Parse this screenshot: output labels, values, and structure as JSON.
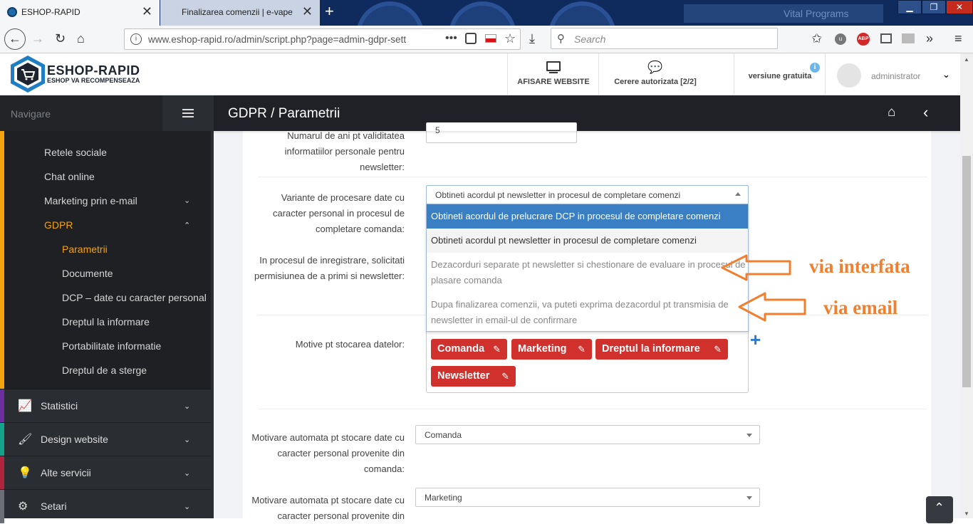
{
  "browser": {
    "tabs": [
      {
        "label": "ESHOP-RAPID",
        "active": true
      },
      {
        "label": "Finalizarea comenzii | e-vape",
        "active": false
      }
    ],
    "background_text": "Vital Programs",
    "url": "www.eshop-rapid.ro/admin/script.php?page=admin-gdpr-sett",
    "search_placeholder": "Search"
  },
  "header": {
    "logo_title": "ESHOP-RAPID",
    "logo_subtitle": "ESHOP VA RECOMPENSEAZA",
    "website_btn": "AFISARE WEBSITE",
    "requests_btn": "Cerere autorizata [2/2]",
    "version": "versiune gratuita",
    "user": "administrator"
  },
  "sidebar": {
    "nav_label": "Navigare",
    "sub_items": [
      {
        "label": "Retele sociale"
      },
      {
        "label": "Chat online"
      },
      {
        "label": "Marketing prin e-mail"
      },
      {
        "label": "GDPR"
      }
    ],
    "gdpr_items": [
      {
        "label": "Parametrii"
      },
      {
        "label": "Documente"
      },
      {
        "label": "DCP – date cu caracter personal"
      },
      {
        "label": "Dreptul la informare"
      },
      {
        "label": "Portabilitate informatie"
      },
      {
        "label": "Dreptul de a sterge"
      }
    ],
    "main_items": [
      {
        "label": "Statistici",
        "color": "#6b2fa0"
      },
      {
        "label": "Design website",
        "color": "#13a38c"
      },
      {
        "label": "Alte servicii",
        "color": "#b0243d"
      },
      {
        "label": "Setari",
        "color": "#6b6f75"
      }
    ]
  },
  "page": {
    "title": "GDPR / Parametrii"
  },
  "form": {
    "field1_label": "Numarul de ani pt validitatea informatiilor personale pentru newsletter:",
    "field1_value": "5",
    "field2_label": "Variante de procesare date cu caracter personal in procesul de completare comanda:",
    "field2_value": "Obtineti acordul pt newsletter in procesul de completare comenzi",
    "field2_options": [
      "Obtineti acordul de prelucrare DCP in procesul de completare comenzi",
      "Obtineti acordul pt newsletter in procesul de completare comenzi",
      "Dezacorduri separate pt newsletter si chestionare de evaluare in procesul de plasare comanda",
      "Dupa finalizarea comenzii, va puteti exprima dezacordul pt transmisia de newsletter in email-ul de confirmare"
    ],
    "field3_label": "In procesul de inregistrare, solicitati permisiunea de a primi si newsletter:",
    "field4_label": "Motive pt stocarea datelor:",
    "tags": [
      "Comanda",
      "Marketing",
      "Dreptul la informare",
      "Newsletter"
    ],
    "field5_label": "Motivare automata pt stocare date cu caracter personal provenite din comanda:",
    "field5_value": "Comanda",
    "field6_label": "Motivare automata pt stocare date cu caracter personal provenite din",
    "field6_value": "Marketing"
  },
  "annotations": {
    "interface": "via interfata",
    "email": "via email",
    "color": "#f08030"
  }
}
